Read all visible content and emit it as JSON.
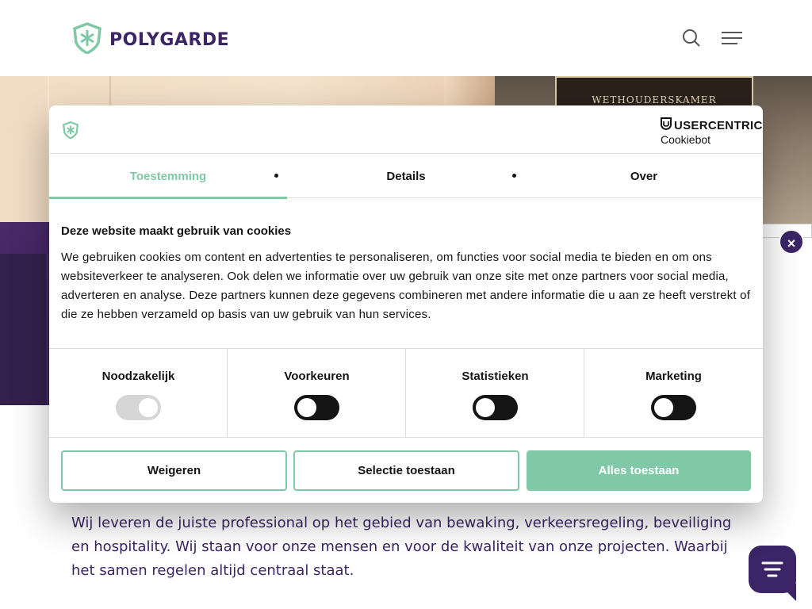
{
  "header": {
    "brand": "POLYGARDE",
    "search_icon": "search-icon",
    "menu_icon": "hamburger-menu-icon"
  },
  "hero": {
    "sign_text": "WETHOUDERSKAMER"
  },
  "body": {
    "paragraph": "Wij leveren de juiste professional op het gebied van bewaking, verkeersregeling, beveiliging en hospitality. Wij staan voor onze mensen en voor de kwaliteit van onze projecten. Waarbij het samen regelen altijd centraal staat."
  },
  "cookie_dialog": {
    "provider": "USERCENTRICS",
    "provider_sub": "Cookiebot",
    "tabs": [
      {
        "label": "Toestemming",
        "active": true
      },
      {
        "label": "Details",
        "active": false
      },
      {
        "label": "Over",
        "active": false
      }
    ],
    "heading": "Deze website maakt gebruik van cookies",
    "text": "We gebruiken cookies om content en advertenties te personaliseren, om functies voor social media te bieden en om ons websiteverkeer te analyseren. Ook delen we informatie over uw gebruik van onze site met onze partners voor social media, adverteren en analyse. Deze partners kunnen deze gegevens combineren met andere informatie die u aan ze heeft verstrekt of die ze hebben verzameld op basis van uw gebruik van hun services.",
    "categories": [
      {
        "label": "Noodzakelijk",
        "state": "on",
        "disabled": true
      },
      {
        "label": "Voorkeuren",
        "state": "off",
        "disabled": false
      },
      {
        "label": "Statistieken",
        "state": "off",
        "disabled": false
      },
      {
        "label": "Marketing",
        "state": "off",
        "disabled": false
      }
    ],
    "buttons": {
      "reject": "Weigeren",
      "allow_selection": "Selectie toestaan",
      "allow_all": "Alles toestaan"
    },
    "close_label": "×"
  },
  "colors": {
    "brand_purple": "#3b2566",
    "accent_green": "#7fc9a6",
    "text_dark": "#141414"
  }
}
